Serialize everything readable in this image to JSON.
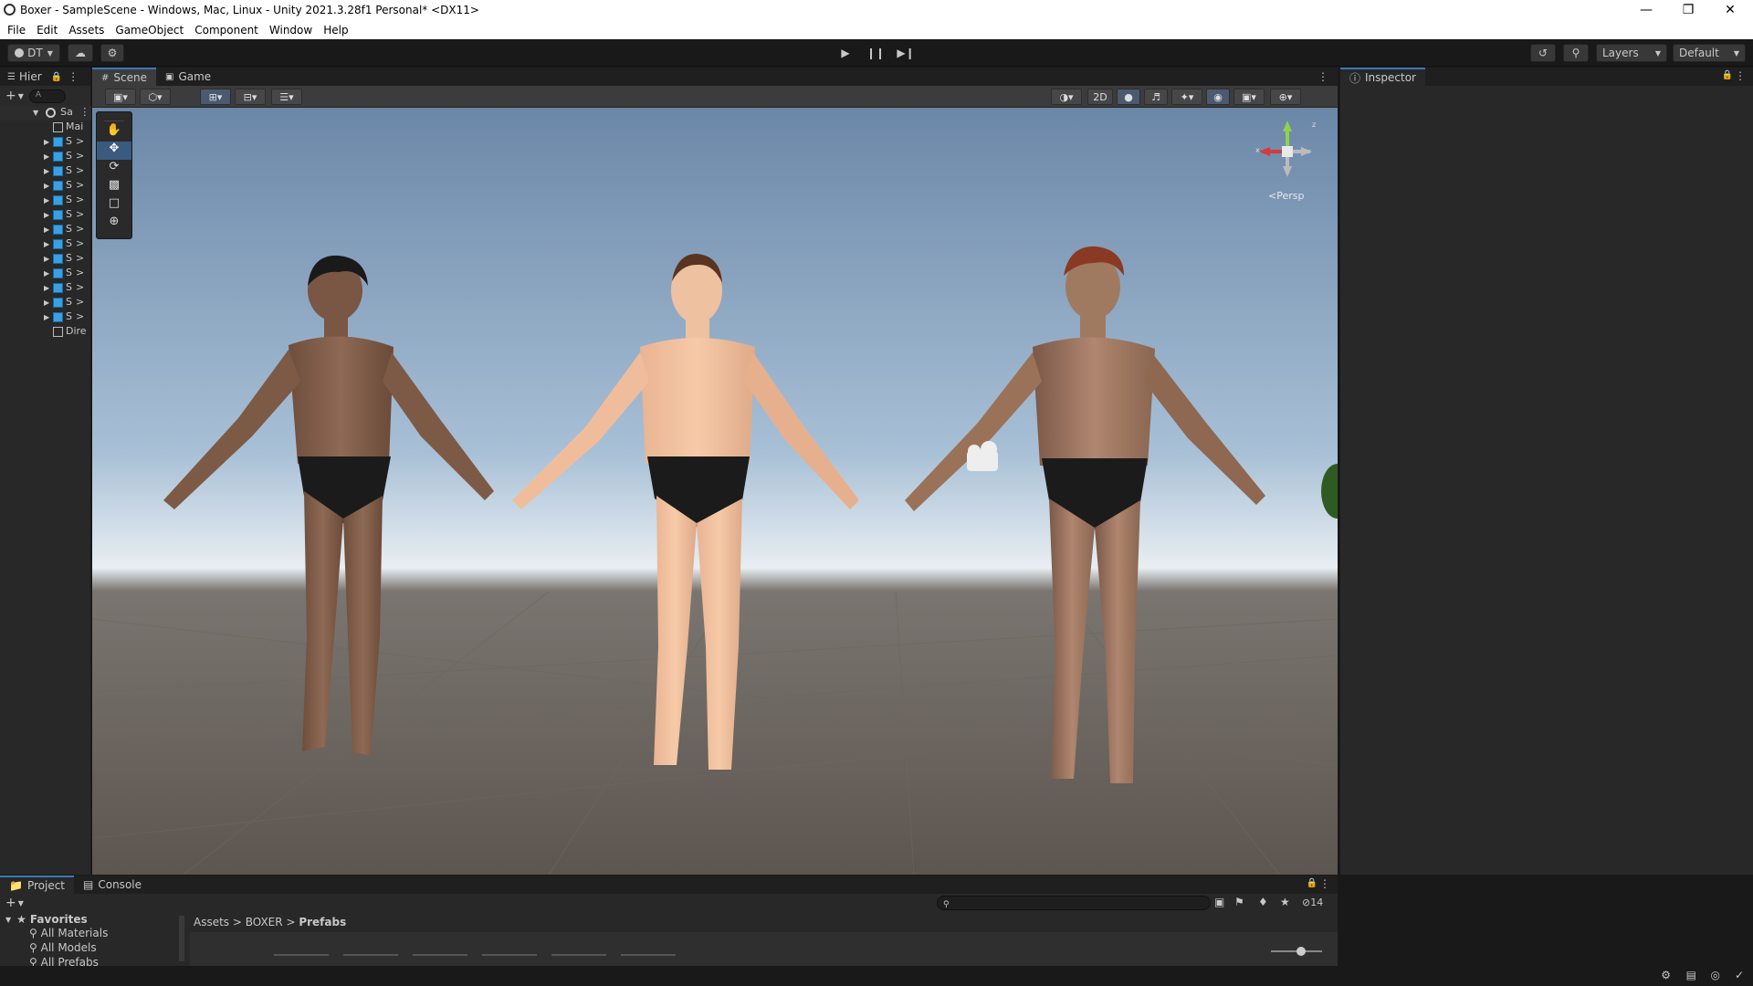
{
  "window": {
    "title": "Boxer - SampleScene - Windows, Mac, Linux - Unity 2021.3.28f1 Personal* <DX11>",
    "controls": [
      "minimize-icon",
      "restore-icon",
      "close-icon"
    ]
  },
  "menu": {
    "items": [
      "File",
      "Edit",
      "Assets",
      "GameObject",
      "Component",
      "Window",
      "Help"
    ]
  },
  "toolbar": {
    "account_label": "DT",
    "layers_label": "Layers",
    "layout_label": "Default"
  },
  "hierarchy": {
    "tab_label": "Hier",
    "search_placeholder": "A",
    "scene_name": "Sa",
    "items": [
      {
        "label": "Mai",
        "kind": "gameobject",
        "expandable": false
      },
      {
        "label": "S",
        "kind": "prefab",
        "expandable": true
      },
      {
        "label": "S",
        "kind": "prefab",
        "expandable": true
      },
      {
        "label": "S",
        "kind": "prefab",
        "expandable": true
      },
      {
        "label": "S",
        "kind": "prefab",
        "expandable": true
      },
      {
        "label": "S",
        "kind": "prefab",
        "expandable": true
      },
      {
        "label": "S",
        "kind": "prefab",
        "expandable": true
      },
      {
        "label": "S",
        "kind": "prefab",
        "expandable": true
      },
      {
        "label": "S",
        "kind": "prefab",
        "expandable": true
      },
      {
        "label": "S",
        "kind": "prefab",
        "expandable": true
      },
      {
        "label": "S",
        "kind": "prefab",
        "expandable": true
      },
      {
        "label": "S",
        "kind": "prefab",
        "expandable": true
      },
      {
        "label": "S",
        "kind": "prefab",
        "expandable": true
      },
      {
        "label": "S",
        "kind": "prefab",
        "expandable": true
      },
      {
        "label": "Dire",
        "kind": "gameobject",
        "expandable": false
      }
    ]
  },
  "scene_view": {
    "tabs": [
      "Scene",
      "Game"
    ],
    "active_tab": "Scene",
    "mode_2d_label": "2D",
    "gizmo_label": "Persp",
    "axes": {
      "x": "x",
      "z": "z"
    }
  },
  "inspector": {
    "tab_label": "Inspector"
  },
  "project": {
    "tabs": [
      "Project",
      "Console"
    ],
    "favorites_label": "Favorites",
    "favorites": [
      "All Materials",
      "All Models",
      "All Prefabs"
    ],
    "breadcrumb": [
      "Assets",
      "BOXER",
      "Prefabs"
    ],
    "hidden_count": "14"
  },
  "colors": {
    "accent": "#3a79bb",
    "prefab_blue": "#3aa0e6",
    "panel_bg": "#282828",
    "toolbar_bg": "#191919"
  }
}
